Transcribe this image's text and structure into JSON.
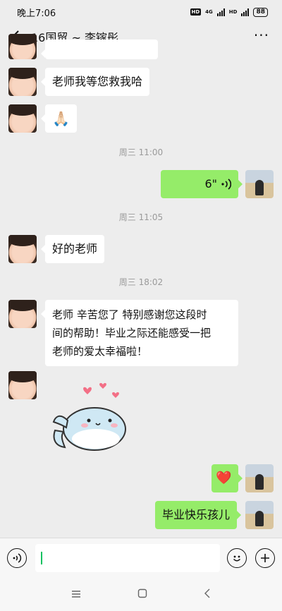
{
  "status_bar": {
    "time": "晚上7:06",
    "hd": "HD",
    "net1": "4G",
    "net2": "HD",
    "battery": "88"
  },
  "header": {
    "title": "16国贸 ~ 李镓彤"
  },
  "messages": {
    "m1": "老师我等您救我哈",
    "m2": "🙏🏻",
    "ts1": "周三 11:00",
    "voice_duration": "6\"",
    "ts2": "周三 11:05",
    "m3": "好的老师",
    "ts3": "周三 18:02",
    "m4_line1": "老师 辛苦您了  特别感谢您这段时",
    "m4_line2": "间的帮助！毕业之际还能感受一把",
    "m4_line3": "老师的爱太幸福啦！",
    "m5": "❤️",
    "m6": "毕业快乐孩儿"
  },
  "input": {
    "value": ""
  },
  "icons": {
    "back": "back-arrow-icon",
    "more": "more-dots-icon",
    "voice": "voice-input-icon",
    "emoji": "emoji-icon",
    "plus": "plus-icon",
    "menu": "menu-icon",
    "home": "home-icon",
    "nav_back": "nav-back-icon"
  },
  "colors": {
    "bubble_sent": "#95ec69",
    "bubble_received": "#ffffff",
    "background": "#ededed",
    "accent": "#07c160"
  }
}
